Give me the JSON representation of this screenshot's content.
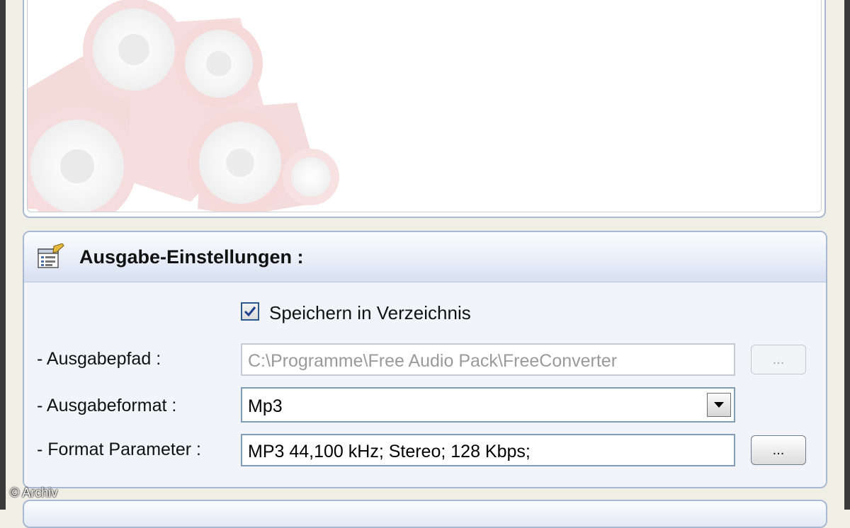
{
  "output_settings": {
    "title": "Ausgabe-Einstellungen :",
    "icon": "settings-list-icon",
    "save_in_directory": {
      "label": "Speichern in Verzeichnis",
      "checked": true
    },
    "output_path": {
      "label": "- Ausgabepfad :",
      "value": "C:\\Programme\\Free Audio Pack\\FreeConverter",
      "browse_label": "...",
      "disabled": true
    },
    "output_format": {
      "label": "- Ausgabeformat :",
      "selected": "Mp3"
    },
    "format_parameters": {
      "label": "- Format Parameter :",
      "value": "MP3 44,100 kHz; Stereo;  128 Kbps;",
      "browse_label": "..."
    }
  },
  "watermark": "© Archiv",
  "colors": {
    "panel_border": "#a9b8d1",
    "header_gradient_end": "#d7e0f0",
    "checkbox_check": "#1f3f8f",
    "speaker_red": "#e8a3a3"
  }
}
